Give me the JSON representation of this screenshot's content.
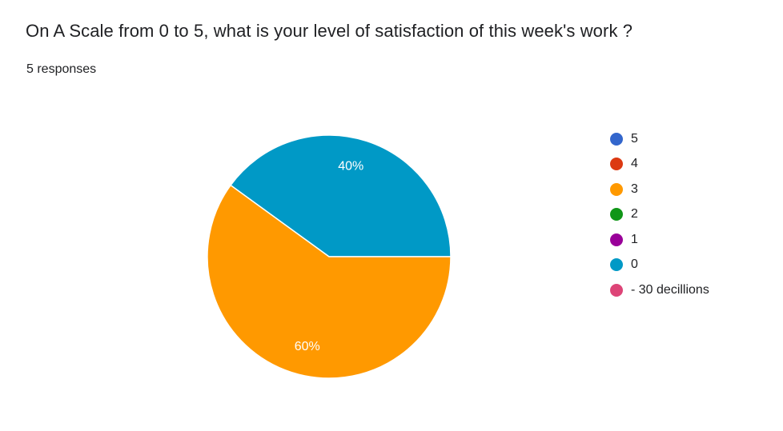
{
  "question": {
    "title": "On A Scale from 0 to 5, what is your level of satisfaction of this week's work ?",
    "responses": "5 responses"
  },
  "chart_data": {
    "type": "pie",
    "title": "On A Scale from 0 to 5, what is your level of satisfaction of this week's work ?",
    "legend_position": "right",
    "categories": [
      "5",
      "4",
      "3",
      "2",
      "1",
      "0",
      "- 30 decillions"
    ],
    "values": [
      0,
      0,
      3,
      0,
      0,
      2,
      0
    ],
    "percent_labels": [
      "",
      "",
      "60%",
      "",
      "",
      "40%",
      ""
    ],
    "colors": [
      "#3366cc",
      "#dc3912",
      "#ff9900",
      "#109618",
      "#990099",
      "#0099c6",
      "#dd4477"
    ]
  }
}
